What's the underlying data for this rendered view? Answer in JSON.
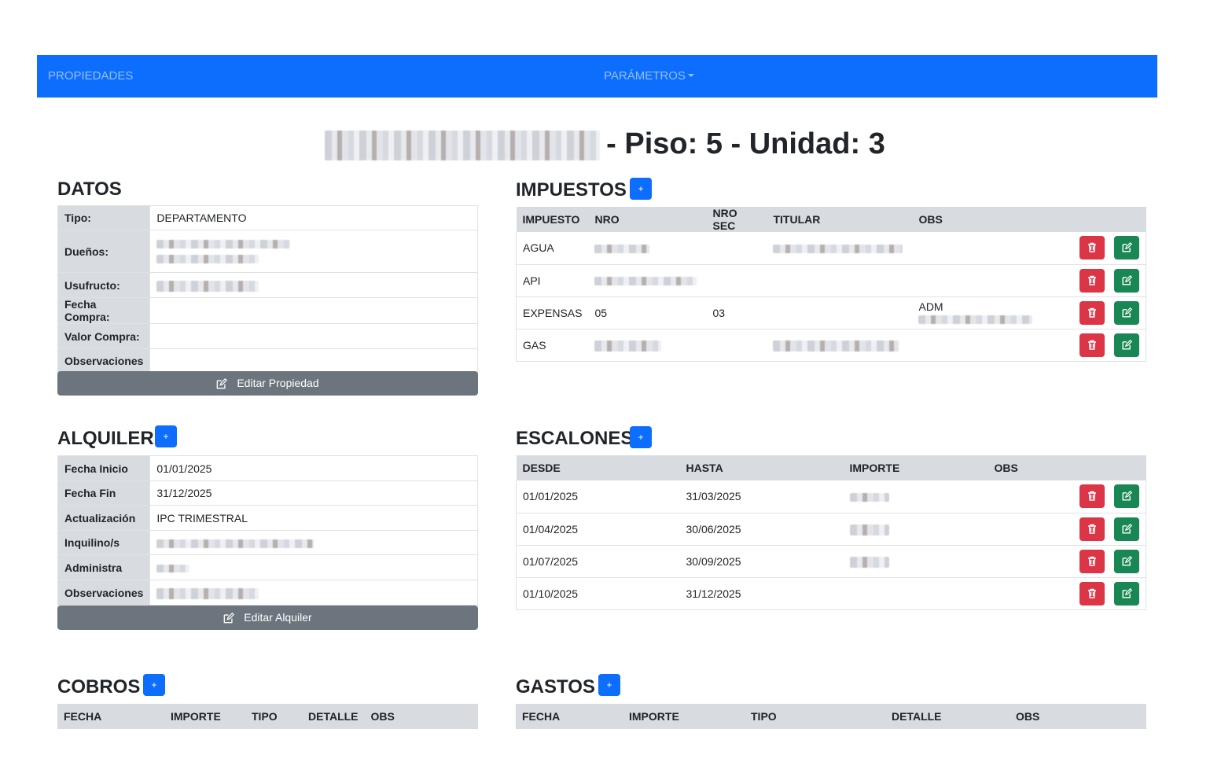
{
  "nav": {
    "brand": "PROPIEDADES",
    "params": "PARÁMETROS"
  },
  "title": {
    "suffix": "- Piso: 5 - Unidad: 3"
  },
  "datos": {
    "title": "DATOS",
    "rows": [
      {
        "label": "Tipo:",
        "value": "DEPARTAMENTO"
      },
      {
        "label": "Dueños:",
        "value": ""
      },
      {
        "label": "Usufructo:",
        "value": ""
      },
      {
        "label": "Fecha Compra:",
        "value": ""
      },
      {
        "label": "Valor Compra:",
        "value": ""
      },
      {
        "label": "Observaciones",
        "value": ""
      }
    ],
    "edit_label": "Editar Propiedad"
  },
  "impuestos": {
    "title": "IMPUESTOS",
    "add_label": "+",
    "headers": [
      "IMPUESTO",
      "NRO",
      "NRO SEC",
      "TITULAR",
      "OBS"
    ],
    "rows": [
      {
        "impuesto": "AGUA",
        "nro": "",
        "nro_sec": "",
        "titular": "",
        "obs": ""
      },
      {
        "impuesto": "API",
        "nro": "",
        "nro_sec": "",
        "titular": "",
        "obs": ""
      },
      {
        "impuesto": "EXPENSAS",
        "nro": "05",
        "nro_sec": "03",
        "titular": "",
        "obs": "ADM"
      },
      {
        "impuesto": "GAS",
        "nro": "",
        "nro_sec": "",
        "titular": "",
        "obs": ""
      }
    ]
  },
  "alquiler": {
    "title": "ALQUILER",
    "add_label": "+",
    "rows": [
      {
        "label": "Fecha Inicio",
        "value": "01/01/2025"
      },
      {
        "label": "Fecha Fin",
        "value": "31/12/2025"
      },
      {
        "label": "Actualización",
        "value": "IPC TRIMESTRAL"
      },
      {
        "label": "Inquilino/s",
        "value": ""
      },
      {
        "label": "Administra",
        "value": ""
      },
      {
        "label": "Observaciones",
        "value": ""
      }
    ],
    "edit_label": "Editar Alquiler"
  },
  "escalones": {
    "title": "ESCALONES",
    "add_label": "+",
    "headers": [
      "DESDE",
      "HASTA",
      "IMPORTE",
      "OBS"
    ],
    "rows": [
      {
        "desde": "01/01/2025",
        "hasta": "31/03/2025",
        "importe": "",
        "obs": ""
      },
      {
        "desde": "01/04/2025",
        "hasta": "30/06/2025",
        "importe": "",
        "obs": ""
      },
      {
        "desde": "01/07/2025",
        "hasta": "30/09/2025",
        "importe": "",
        "obs": ""
      },
      {
        "desde": "01/10/2025",
        "hasta": "31/12/2025",
        "importe": "",
        "obs": ""
      }
    ]
  },
  "cobros": {
    "title": "COBROS",
    "add_label": "+",
    "headers": [
      "FECHA",
      "IMPORTE",
      "TIPO",
      "DETALLE",
      "OBS"
    ]
  },
  "gastos": {
    "title": "GASTOS",
    "add_label": "+",
    "headers": [
      "FECHA",
      "IMPORTE",
      "TIPO",
      "DETALLE",
      "OBS"
    ]
  },
  "icons": {
    "delete": "trash-icon",
    "edit": "pencil-square-icon",
    "dropdown": "caret-down-icon"
  },
  "colors": {
    "primary": "#0d6efd",
    "danger": "#dc3545",
    "success": "#198754",
    "secondary": "#6c757d",
    "header_bg": "#d8dce1"
  }
}
